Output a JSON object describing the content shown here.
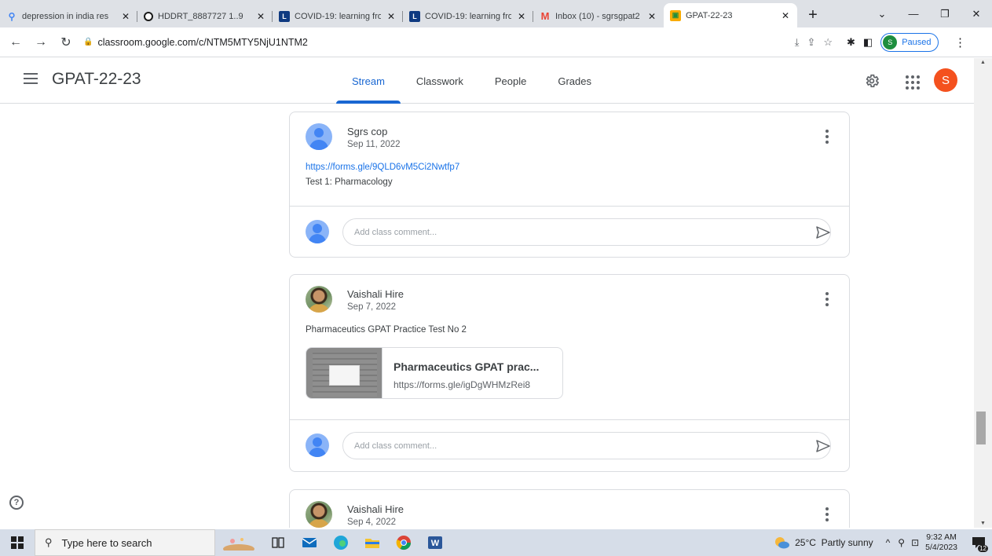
{
  "browser": {
    "tabs": [
      {
        "title": "depression in india res",
        "favicon": "search-icon",
        "favicon_color": "#4285f4"
      },
      {
        "title": "HDDRT_8887727 1..9",
        "favicon": "turnitin-icon",
        "favicon_color": "#1a1a1a"
      },
      {
        "title": "COVID-19: learning fro",
        "favicon": "l-icon",
        "favicon_color": "#0f3a80"
      },
      {
        "title": "COVID-19: learning fro",
        "favicon": "l-icon",
        "favicon_color": "#0f3a80"
      },
      {
        "title": "Inbox (10) - sgrsgpat2",
        "favicon": "gmail-icon",
        "favicon_color": "#ea4335"
      },
      {
        "title": "GPAT-22-23",
        "favicon": "classroom-icon",
        "favicon_color": "#f9ab00"
      }
    ],
    "url": "classroom.google.com/c/NTM5MTY5NjU1NTM2",
    "profile_initial": "S",
    "profile_status": "Paused"
  },
  "classroom": {
    "class_title": "GPAT-22-23",
    "tabs": [
      "Stream",
      "Classwork",
      "People",
      "Grades"
    ],
    "active_tab": "Stream",
    "user_initial": "S"
  },
  "posts": [
    {
      "author": "Sgrs cop",
      "date": "Sep 11, 2022",
      "link": "https://forms.gle/9QLD6vM5Ci2Nwtfp7",
      "text": "Test 1: Pharmacology",
      "comment_placeholder": "Add class comment..."
    },
    {
      "author": "Vaishali Hire",
      "date": "Sep 7, 2022",
      "text": "Pharmaceutics GPAT Practice Test No 2",
      "attachment_title": "Pharmaceutics GPAT prac...",
      "attachment_url": "https://forms.gle/igDgWHMzRei8",
      "comment_placeholder": "Add class comment..."
    },
    {
      "author": "Vaishali Hire",
      "date": "Sep 4, 2022"
    }
  ],
  "taskbar": {
    "search_placeholder": "Type here to search",
    "weather": "25°C  Partly sunny",
    "time": "9:32 AM",
    "date": "5/4/2023",
    "notification_count": "12"
  }
}
